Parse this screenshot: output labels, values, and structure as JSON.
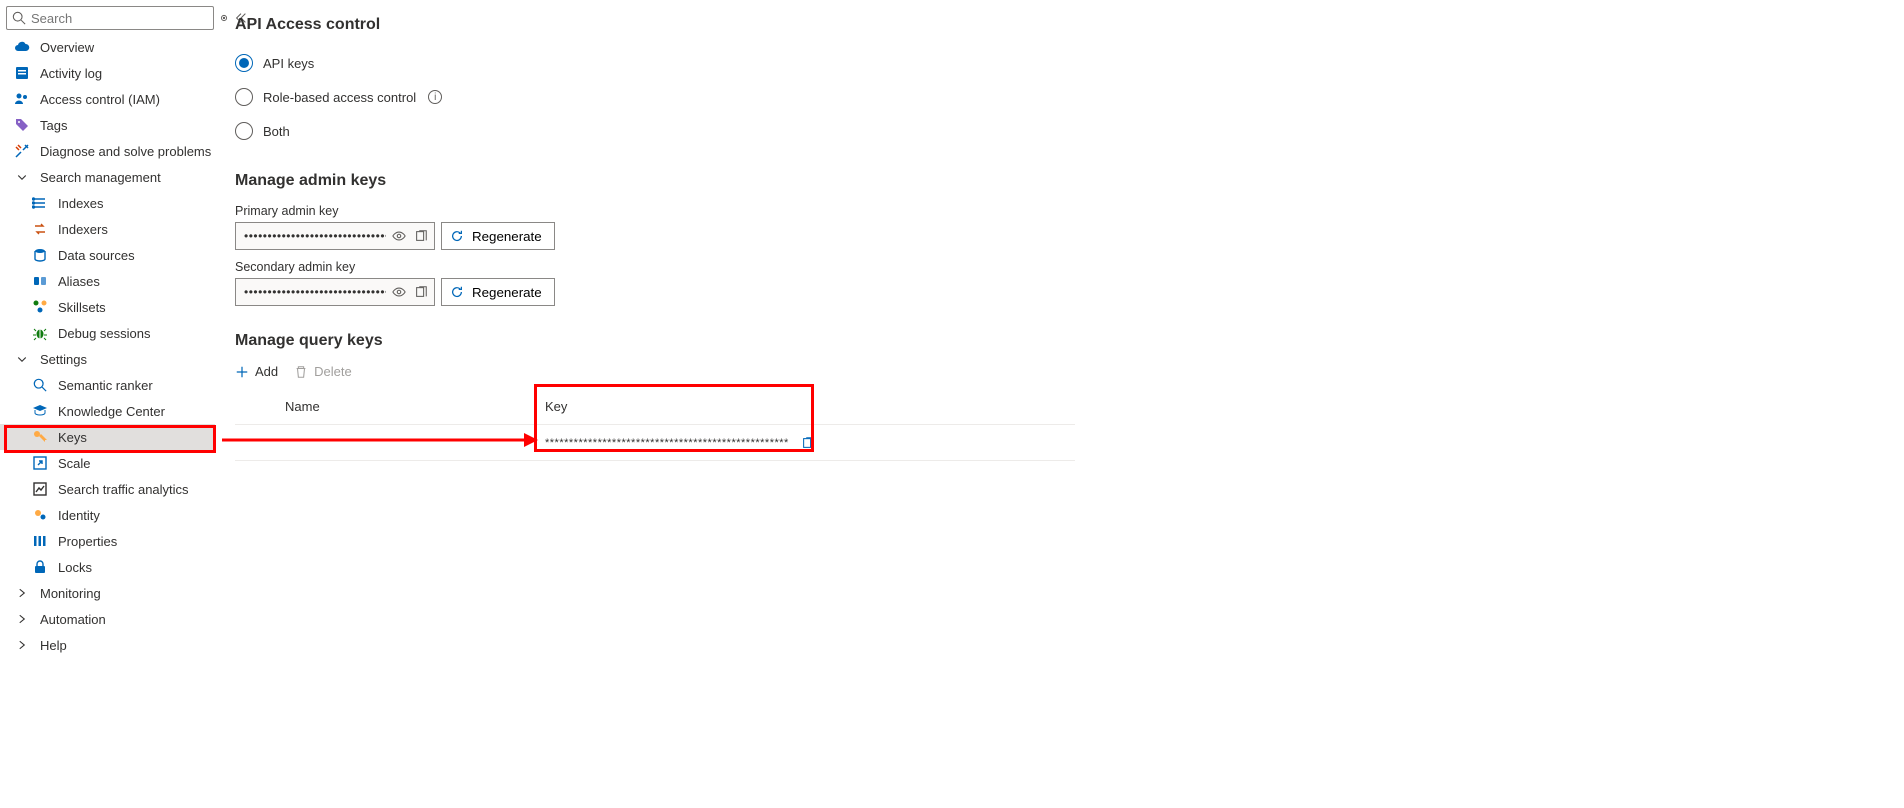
{
  "sidebar": {
    "search_placeholder": "Search",
    "top_items": [
      {
        "id": "overview",
        "label": "Overview"
      },
      {
        "id": "activity-log",
        "label": "Activity log"
      },
      {
        "id": "access-control",
        "label": "Access control (IAM)"
      },
      {
        "id": "tags",
        "label": "Tags"
      },
      {
        "id": "diagnose",
        "label": "Diagnose and solve problems"
      }
    ],
    "group_search_mgmt": "Search management",
    "search_mgmt_items": [
      {
        "id": "indexes",
        "label": "Indexes"
      },
      {
        "id": "indexers",
        "label": "Indexers"
      },
      {
        "id": "data-sources",
        "label": "Data sources"
      },
      {
        "id": "aliases",
        "label": "Aliases"
      },
      {
        "id": "skillsets",
        "label": "Skillsets"
      },
      {
        "id": "debug-sessions",
        "label": "Debug sessions"
      }
    ],
    "group_settings": "Settings",
    "settings_items": [
      {
        "id": "semantic-ranker",
        "label": "Semantic ranker"
      },
      {
        "id": "knowledge-center",
        "label": "Knowledge Center"
      },
      {
        "id": "keys",
        "label": "Keys"
      },
      {
        "id": "scale",
        "label": "Scale"
      },
      {
        "id": "search-traffic",
        "label": "Search traffic analytics"
      },
      {
        "id": "identity",
        "label": "Identity"
      },
      {
        "id": "properties",
        "label": "Properties"
      },
      {
        "id": "locks",
        "label": "Locks"
      }
    ],
    "group_monitoring": "Monitoring",
    "group_automation": "Automation",
    "group_help": "Help"
  },
  "main": {
    "api_access_title": "API Access control",
    "radio_api_keys": "API keys",
    "radio_rbac": "Role-based access control",
    "radio_both": "Both",
    "manage_admin_title": "Manage admin keys",
    "primary_label": "Primary admin key",
    "secondary_label": "Secondary admin key",
    "primary_value": "•••••••••••••••••••••••••••••••••••••••••••••••...",
    "secondary_value": "•••••••••••••••••••••••••••••••••••••••••••••••...",
    "regenerate_label": "Regenerate",
    "manage_query_title": "Manage query keys",
    "add_label": "Add",
    "delete_label": "Delete",
    "col_name": "Name",
    "col_key": "Key",
    "query_rows": [
      {
        "name": "",
        "key": "***************************************************"
      }
    ]
  }
}
